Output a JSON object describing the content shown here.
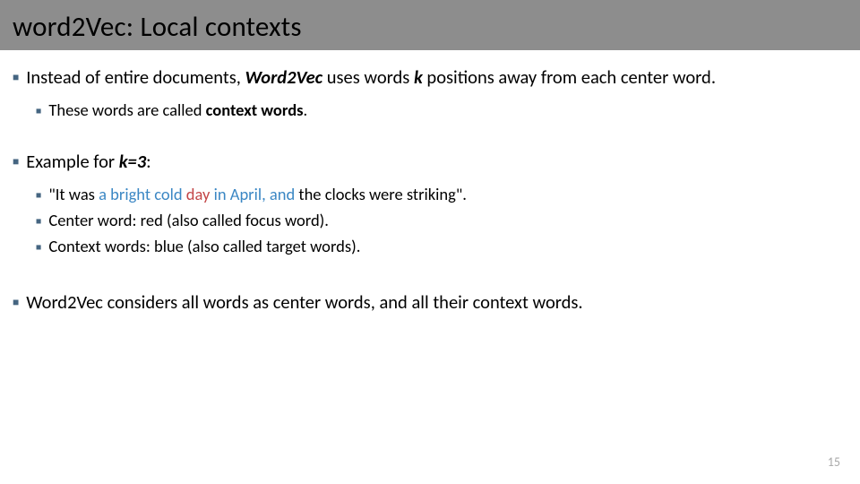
{
  "title": "word2Vec: Local contexts",
  "p1": {
    "pre": "Instead of entire documents, ",
    "em1": "Word2Vec",
    "mid1": " uses words ",
    "em2": "k",
    "mid2": " positions away from each center word."
  },
  "p1a": {
    "pre": "These words are called ",
    "bold": "context words",
    "post": "."
  },
  "p2": {
    "pre": "Example for ",
    "em": "k=3",
    "post": ":"
  },
  "p2a": {
    "q1": "\"It was ",
    "blue1": "a bright cold ",
    "red": "day",
    "blue2": " in April, and",
    "q2": " the clocks were striking\"."
  },
  "p2b": "Center word: red (also called focus word).",
  "p2c": "Context words: blue (also called target words).",
  "p3": "Word2Vec considers all words as center words, and all their context words.",
  "page": "15"
}
